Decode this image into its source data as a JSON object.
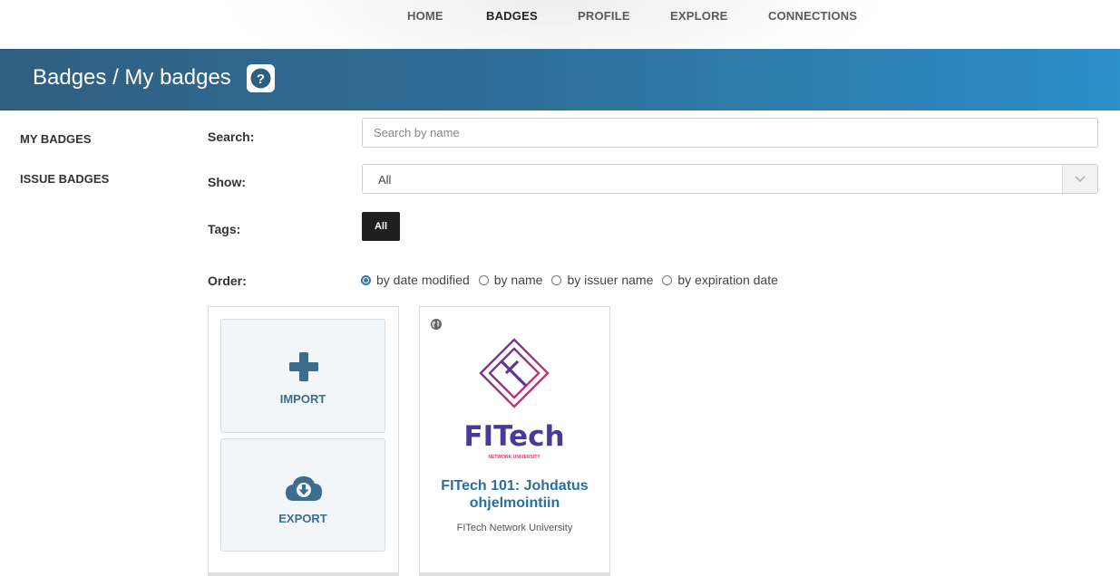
{
  "nav": {
    "items": [
      "HOME",
      "BADGES",
      "PROFILE",
      "EXPLORE",
      "CONNECTIONS"
    ],
    "active": "BADGES"
  },
  "header": {
    "title": "Badges / My badges"
  },
  "sidebar": {
    "items": [
      {
        "label": "MY BADGES"
      },
      {
        "label": "ISSUE BADGES"
      }
    ]
  },
  "filters": {
    "search_label": "Search:",
    "search_placeholder": "Search by name",
    "show_label": "Show:",
    "show_value": "All",
    "tags_label": "Tags:",
    "tag_all": "All",
    "order_label": "Order:",
    "order_options": [
      {
        "label": "by date modified",
        "checked": true
      },
      {
        "label": "by name",
        "checked": false
      },
      {
        "label": "by issuer name",
        "checked": false
      },
      {
        "label": "by expiration date",
        "checked": false
      }
    ]
  },
  "actions": {
    "import_label": "IMPORT",
    "export_label": "EXPORT"
  },
  "badge": {
    "logo_text": "FITech",
    "logo_subtext": "NETWORK UNIVERSITY",
    "title_line1": "FITech 101: Johdatus",
    "title_line2": "ohjelmointiin",
    "issuer": "FITech Network University",
    "visibility_icon": "globe-icon"
  },
  "colors": {
    "header_start": "#2f5f80",
    "header_end": "#2b8fc8",
    "link": "#2b6f9c",
    "logo_purple": "#4a3a97",
    "logo_pink": "#e8336d"
  }
}
